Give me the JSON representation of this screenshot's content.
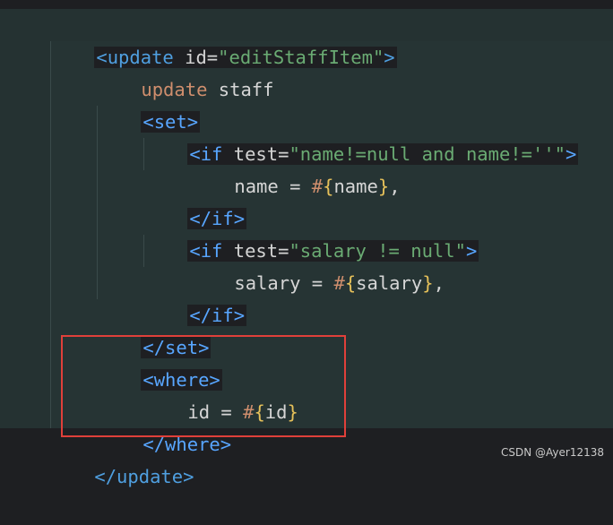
{
  "code": {
    "l1": {
      "open": "<update",
      "attr": " id=",
      "val": "\"editStaffItem\"",
      "close": ">"
    },
    "l2": {
      "kw": "update",
      "rest": " staff"
    },
    "l3": {
      "tag": "<set>"
    },
    "l4": {
      "open": "<if",
      "attr": " test=",
      "val": "\"name!=null and name!=''\"",
      "close": ">"
    },
    "l5": {
      "pre": "name = ",
      "hash": "#",
      "lb": "{",
      "name": "name",
      "rb": "}",
      "post": ","
    },
    "l6": {
      "tag": "</if>"
    },
    "l7": {
      "open": "<if",
      "attr": " test=",
      "val": "\"salary != null\"",
      "close": ">"
    },
    "l8": {
      "pre": "salary = ",
      "hash": "#",
      "lb": "{",
      "name": "salary",
      "rb": "}",
      "post": ","
    },
    "l9": {
      "tag": "</if>"
    },
    "l10": {
      "tag": "</set>"
    },
    "l11": {
      "tag": "<where>"
    },
    "l12": {
      "pre": "id = ",
      "hash": "#",
      "lb": "{",
      "name": "id",
      "rb": "}"
    },
    "l13": {
      "tag": "</where>"
    },
    "l14": {
      "tag": "</update>"
    }
  },
  "watermark": "CSDN @Ayer12138",
  "colors": {
    "tag": "#4f9fe0",
    "string": "#6aab73",
    "keyword": "#cf8e6d",
    "brace": "#e6c15a",
    "highlight_box": "#e0403a"
  }
}
